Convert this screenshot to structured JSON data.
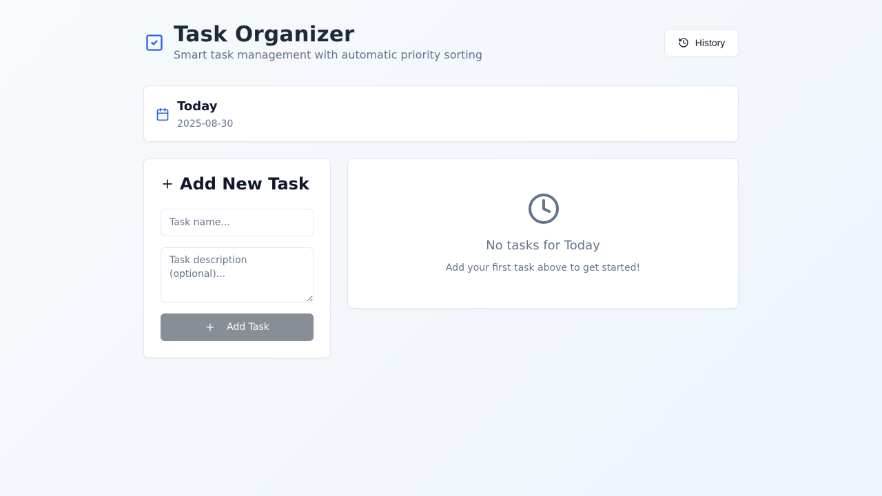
{
  "app": {
    "title": "Task Organizer",
    "subtitle": "Smart task management with automatic priority sorting",
    "accent_color": "#2563eb"
  },
  "header": {
    "logo_icon": "check-square-icon",
    "history_label": "History",
    "history_icon": "history-icon"
  },
  "today": {
    "icon": "calendar-icon",
    "label": "Today",
    "date": "2025-08-30"
  },
  "add_task": {
    "icon": "plus-icon",
    "title": "Add New Task",
    "name_placeholder": "Task name...",
    "name_value": "",
    "description_placeholder": "Task description (optional)...",
    "description_value": "",
    "button_label": "Add Task",
    "button_disabled": true
  },
  "empty_state": {
    "icon": "clock-icon",
    "title": "No tasks for Today",
    "subtitle": "Add your first task above to get started!"
  }
}
